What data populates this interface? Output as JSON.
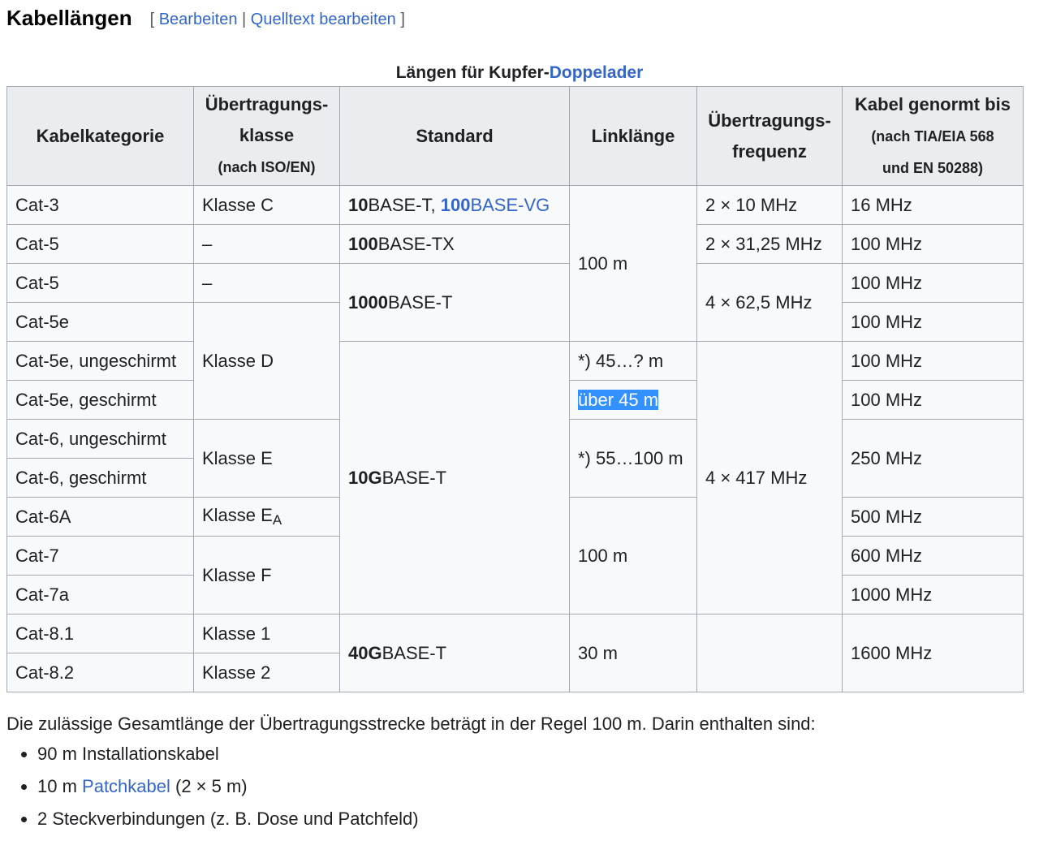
{
  "heading": {
    "title": "Kabellängen",
    "bracket_open": "[ ",
    "edit": "Bearbeiten",
    "sep": " | ",
    "edit_source": "Quelltext bearbeiten",
    "bracket_close": " ]"
  },
  "caption": {
    "prefix": "Längen für Kupfer-",
    "link": "Doppelader"
  },
  "headers": {
    "c1": "Kabelkategorie",
    "c2_a": "Übertragungs-",
    "c2_b": "klasse",
    "c2_c": "(nach ISO/EN)",
    "c3": "Standard",
    "c4": "Linklänge",
    "c5_a": "Übertragungs-",
    "c5_b": "frequenz",
    "c6_a": "Kabel genormt bis",
    "c6_b": "(nach TIA/EIA 568",
    "c6_c": "und EN 50288)"
  },
  "cells": {
    "r1_cat": "Cat-3",
    "r1_class": "Klasse C",
    "r1_std_b1": "10",
    "r1_std_t1": "BASE-T, ",
    "r1_std_b2": "100",
    "r1_std_t2": "BASE-VG",
    "r1_freq": "2 × 10 MHz",
    "r1_norm": "16 MHz",
    "r2_cat": "Cat-5",
    "r2_class": "–",
    "r2_std_b": "100",
    "r2_std_t": "BASE-TX",
    "r2_freq": "2 × 31,25 MHz",
    "r2_norm": "100 MHz",
    "link_100a": "100 m",
    "r3_cat": "Cat-5",
    "r3_class": "–",
    "r3_std_b": "1000",
    "r3_std_t": "BASE-T",
    "r3_freq": "4 × 62,5 MHz",
    "r3_norm": "100 MHz",
    "r4_cat": "Cat-5e",
    "r4_norm": "100 MHz",
    "classD": "Klasse D",
    "r5_cat": "Cat-5e, ungeschirmt",
    "r5_link": "*) 45…? m",
    "r5_norm": "100 MHz",
    "r6_cat": "Cat-5e, geschirmt",
    "r6_link": "über 45 m",
    "r6_norm": "100 MHz",
    "std_10g_b": "10G",
    "std_10g_t": "BASE-T",
    "freq_417": "4 × 417 MHz",
    "r7_cat": "Cat-6, ungeschirmt",
    "classE": "Klasse E",
    "link_55": "*) 55…100 m",
    "norm_250": "250 MHz",
    "r8_cat": "Cat-6, geschirmt",
    "r9_cat": "Cat-6A",
    "classEA": "Klasse E",
    "classEA_sub": "A",
    "r9_norm": "500 MHz",
    "link_100b": "100 m",
    "r10_cat": "Cat-7",
    "classF": "Klasse F",
    "r10_norm": "600 MHz",
    "r11_cat": "Cat-7a",
    "r11_norm": "1000 MHz",
    "r12_cat": "Cat-8.1",
    "r12_class": "Klasse 1",
    "std_40g_b": "40G",
    "std_40g_t": "BASE-T",
    "link_30": "30 m",
    "norm_1600": "1600 MHz",
    "r13_cat": "Cat-8.2",
    "r13_class": "Klasse 2"
  },
  "note": "Die zulässige Gesamtlänge der Übertragungsstrecke beträgt in der Regel 100 m. Darin enthalten sind:",
  "list": {
    "i1": "90 m Installationskabel",
    "i2_pre": "10 m ",
    "i2_link": "Patchkabel",
    "i2_post": " (2 × 5 m)",
    "i3": "2 Steckverbindungen (z. B. Dose und Patchfeld)"
  },
  "colors": {
    "link": "#3366cc",
    "header_bg": "#eaecf0",
    "table_bg": "#f8f9fa",
    "border": "#a2a9b1",
    "selection": "#3390ff"
  }
}
